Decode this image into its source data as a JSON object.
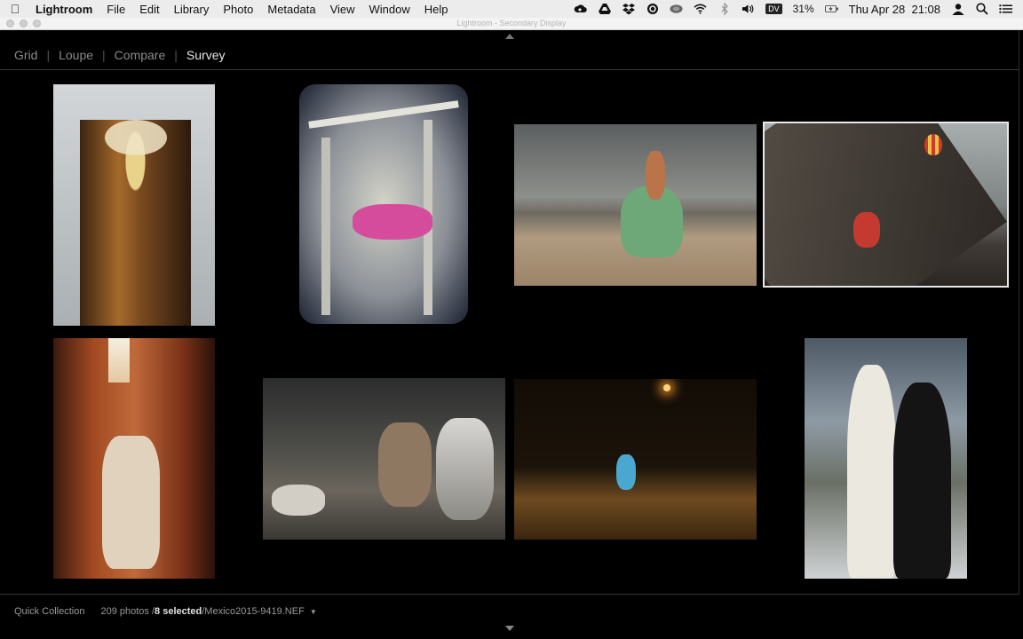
{
  "menubar": {
    "app_name": "Lightroom",
    "menus": [
      "File",
      "Edit",
      "Library",
      "Photo",
      "Metadata",
      "View",
      "Window",
      "Help"
    ],
    "status_icons": [
      "creative-cloud-icon",
      "google-drive-icon",
      "dropbox-icon",
      "sync-icon",
      "cloud-icon",
      "wifi-icon",
      "bluetooth-icon",
      "volume-icon"
    ],
    "badge": "DV",
    "battery": "31%",
    "clock": "Thu Apr 28  21:08"
  },
  "window": {
    "title": "Lightroom - Secondary Display"
  },
  "view_modes": {
    "tabs": [
      "Grid",
      "Loupe",
      "Compare",
      "Survey"
    ],
    "active": "Survey"
  },
  "photos": [
    {
      "subject": "blond man in striped robe",
      "selected": false,
      "palette": [
        "#d8dadb",
        "#5a3a20",
        "#c9a060"
      ]
    },
    {
      "subject": "woman among metal scaffolding",
      "selected": false,
      "palette": [
        "#c9c9c0",
        "#7a7f84",
        "#d04a9a"
      ]
    },
    {
      "subject": "woman in green dress on sand",
      "selected": false,
      "palette": [
        "#7d7f7c",
        "#a89479",
        "#6fa277"
      ]
    },
    {
      "subject": "dancer on pyramid with balloons",
      "selected": true,
      "palette": [
        "#8f979a",
        "#4a4440",
        "#c53a30"
      ]
    },
    {
      "subject": "woman in red canyon",
      "selected": false,
      "palette": [
        "#7a3218",
        "#d9c7b0",
        "#3a1a10"
      ]
    },
    {
      "subject": "woman with husky dog",
      "selected": false,
      "palette": [
        "#3a3a38",
        "#8a7b6a",
        "#c8c3b8"
      ]
    },
    {
      "subject": "girl in blue dress on night road",
      "selected": false,
      "palette": [
        "#1a1208",
        "#8a5a22",
        "#4aa7d0"
      ]
    },
    {
      "subject": "two women in white and black gowns",
      "selected": false,
      "palette": [
        "#6f7c88",
        "#e8e8e0",
        "#151515"
      ]
    }
  ],
  "footer": {
    "source": "Quick Collection",
    "count": "209 photos /",
    "selected": "8 selected",
    "filename": "/Mexico2015-9419.NEF"
  }
}
